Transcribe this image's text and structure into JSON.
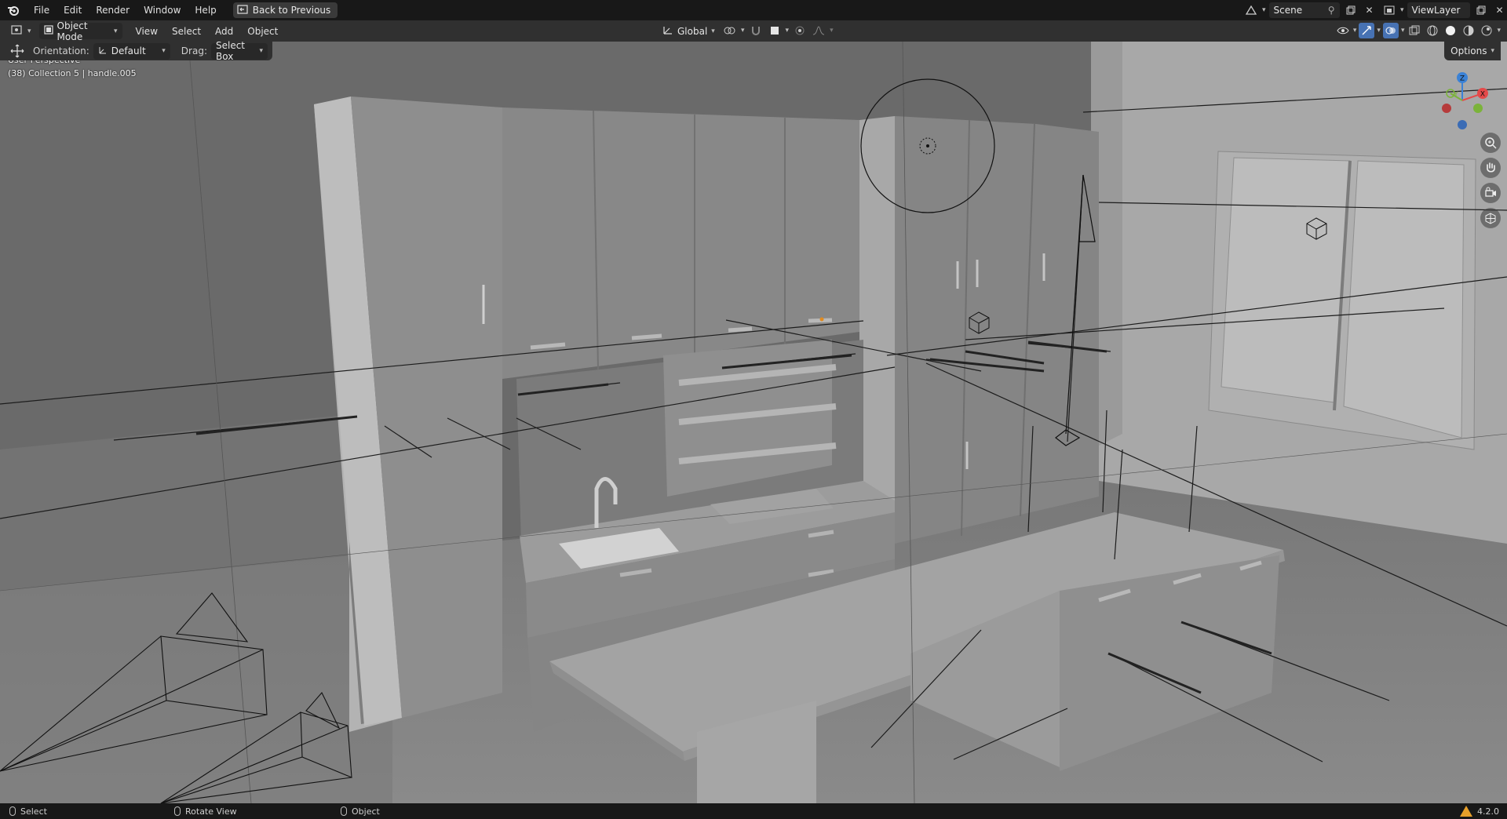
{
  "menubar": {
    "items": [
      "File",
      "Edit",
      "Render",
      "Window",
      "Help"
    ],
    "back_button": "Back to Previous",
    "scene": "Scene",
    "view_layer": "ViewLayer"
  },
  "header": {
    "mode": "Object Mode",
    "menus": [
      "View",
      "Select",
      "Add",
      "Object"
    ],
    "transform_orientation": "Global"
  },
  "tool_settings": {
    "orientation_label": "Orientation:",
    "orientation_value": "Default",
    "drag_label": "Drag:",
    "drag_value": "Select Box"
  },
  "viewport": {
    "perspective_label": "User Perspective",
    "active_object_info": "(38) Collection 5 | handle.005",
    "options_label": "Options"
  },
  "gizmo": {
    "x_label": "X",
    "y_label": "Y",
    "z_label": "Z"
  },
  "statusbar": {
    "select": "Select",
    "rotate": "Rotate View",
    "object": "Object",
    "version": "4.2.0"
  },
  "colors": {
    "accent": "#4772b3",
    "axis_x": "#e44a4a",
    "axis_y": "#7bb33a",
    "axis_z": "#3b82d6",
    "warning": "#e8a02a"
  }
}
